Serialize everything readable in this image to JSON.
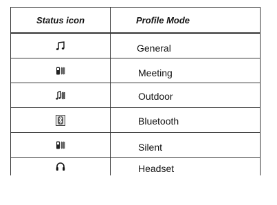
{
  "table": {
    "headers": {
      "status_icon": "Status icon",
      "profile_mode": "Profile Mode"
    },
    "rows": [
      {
        "icon": "music-note-icon",
        "mode": "General"
      },
      {
        "icon": "phone-vibrate-icon",
        "mode": "Meeting"
      },
      {
        "icon": "music-note-vibrate-icon",
        "mode": "Outdoor"
      },
      {
        "icon": "bluetooth-icon",
        "mode": "Bluetooth"
      },
      {
        "icon": "phone-vibrate-icon",
        "mode": "Silent"
      },
      {
        "icon": "headset-icon",
        "mode": "Headset"
      }
    ]
  }
}
